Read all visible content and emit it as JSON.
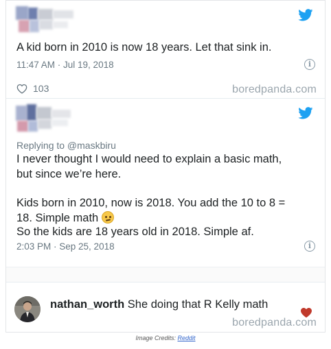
{
  "tweet1": {
    "text": "A kid born in 2010 is now 18 years. Let that sink in.",
    "timestamp": "11:47 AM · Jul 19, 2018",
    "likes": "103",
    "brand": "boredpanda.com",
    "colors": {
      "twitter_blue": "#1da1f2"
    }
  },
  "tweet2": {
    "replying_to": "Replying to @maskbiru",
    "lines": [
      "I never thought I would need to explain a basic math,",
      "but since we’re here.",
      "Kids born in 2010, now is 2018. You add the 10 to 8 =",
      "18. Simple math",
      "So the kids are 18 years old in 2018. Simple af."
    ],
    "emoji": "rolling-eyes-emoji",
    "timestamp": "2:03 PM · Sep 25, 2018"
  },
  "comment": {
    "username": "nathan_worth",
    "text": "She doing that R Kelly math",
    "brand": "boredpanda.com",
    "heart_color": "#c0392b"
  },
  "credits": {
    "label": "Image Credits:",
    "link": "Reddit"
  }
}
